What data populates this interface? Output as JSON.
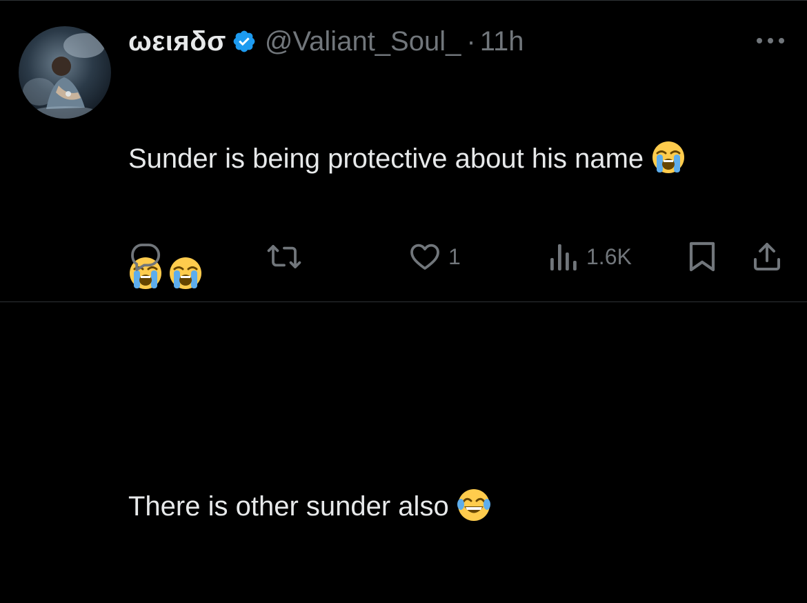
{
  "user": {
    "display_name": "ωειяδσ",
    "handle": "@Valiant_Soul_",
    "separator": "·",
    "time": "11h",
    "verified": true
  },
  "tweet": {
    "line1": "Sunder is being protective about his name",
    "line3": "There is other sunder also",
    "emojis": [
      "loudly-crying-face",
      "loudly-crying-face",
      "loudly-crying-face",
      "face-with-tears-of-joy"
    ]
  },
  "actions": {
    "reply_count": "",
    "repost_count": "",
    "like_count": "1",
    "views_count": "1.6K"
  },
  "colors": {
    "background": "#000000",
    "text": "#e7e9ea",
    "secondary": "#71767b",
    "verified": "#1d9bf0",
    "divider": "#2f3336"
  }
}
